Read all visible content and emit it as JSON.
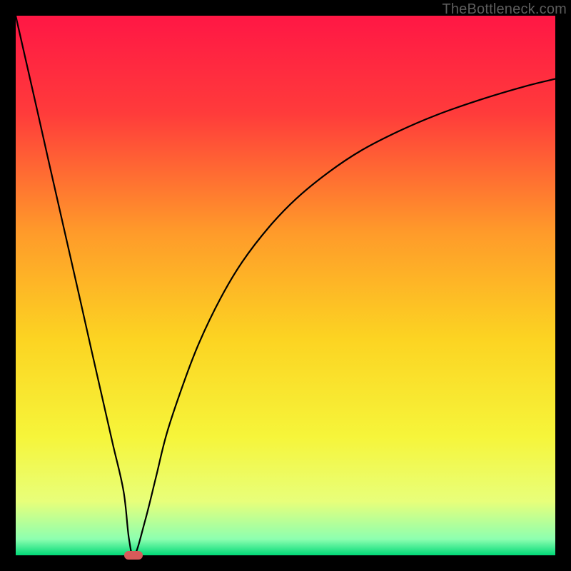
{
  "watermark": "TheBottleneck.com",
  "chart_data": {
    "type": "line",
    "title": "",
    "xlabel": "",
    "ylabel": "",
    "xlim": [
      0,
      100
    ],
    "ylim": [
      0,
      100
    ],
    "grid": false,
    "background_gradient": {
      "stops": [
        {
          "offset": 0.0,
          "color": "#ff1745"
        },
        {
          "offset": 0.18,
          "color": "#ff3b3b"
        },
        {
          "offset": 0.4,
          "color": "#ff9a2a"
        },
        {
          "offset": 0.6,
          "color": "#fcd422"
        },
        {
          "offset": 0.78,
          "color": "#f6f53a"
        },
        {
          "offset": 0.9,
          "color": "#e8ff7a"
        },
        {
          "offset": 0.97,
          "color": "#8dffb0"
        },
        {
          "offset": 1.0,
          "color": "#00d977"
        }
      ]
    },
    "curve": {
      "x": [
        0,
        2,
        4,
        6,
        8,
        10,
        12,
        14,
        16,
        18,
        20,
        21,
        22,
        24,
        26,
        28,
        31,
        34,
        38,
        42,
        47,
        52,
        58,
        64,
        71,
        78,
        86,
        94,
        100
      ],
      "y": [
        100,
        91.2,
        82.4,
        73.5,
        64.7,
        55.9,
        47.1,
        38.2,
        29.4,
        20.6,
        11.8,
        3.0,
        0.0,
        6.5,
        14.5,
        22.6,
        31.6,
        39.4,
        47.7,
        54.4,
        60.9,
        66.1,
        71.0,
        75.0,
        78.6,
        81.6,
        84.4,
        86.8,
        88.3
      ]
    },
    "marker": {
      "x": 21.8,
      "y": 0.0,
      "color": "#d85a5a",
      "shape": "pill"
    }
  }
}
